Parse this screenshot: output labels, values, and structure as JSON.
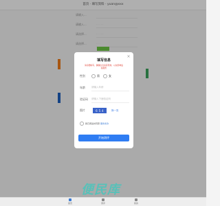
{
  "background": {
    "top_title": "首页 · 填写资料 · yuan@xxx",
    "form_rows": [
      {
        "label": "请输入...",
        "value": ""
      },
      {
        "label": "请输入...",
        "value": "·  ·  ·  ·  ·"
      },
      {
        "label": "请选择...",
        "value": "·  ·  ·  ·  ·"
      },
      {
        "label": "请选择...",
        "value": "·  ·  ·"
      }
    ]
  },
  "dialog": {
    "title": "填写信息",
    "close_icon": "×",
    "note": "请仔细填写，确保信息真实有效，以免影响后续服务",
    "gender_label": "性别",
    "gender_male": "男",
    "gender_female": "女",
    "age_label": "年龄",
    "age_placeholder": "请输入年龄",
    "captcha_label": "验证码",
    "captcha_placeholder": "请输入下面验证码",
    "image_label": "图片",
    "captcha_text": "6 5 4",
    "refresh_label": "换一张",
    "agree_text": "我已阅读并同意",
    "agree_link": "服务条款",
    "start_button": "开始测评"
  },
  "watermark": "便民库",
  "tabs": [
    {
      "label": "首页",
      "color": "#3a7bd5"
    },
    {
      "label": "测评",
      "color": "#888888"
    },
    {
      "label": "我的",
      "color": "#888888"
    }
  ],
  "colors": {
    "accent": "#2f7df3",
    "warning": "#e0463a",
    "watermark": "#3cc8be"
  }
}
